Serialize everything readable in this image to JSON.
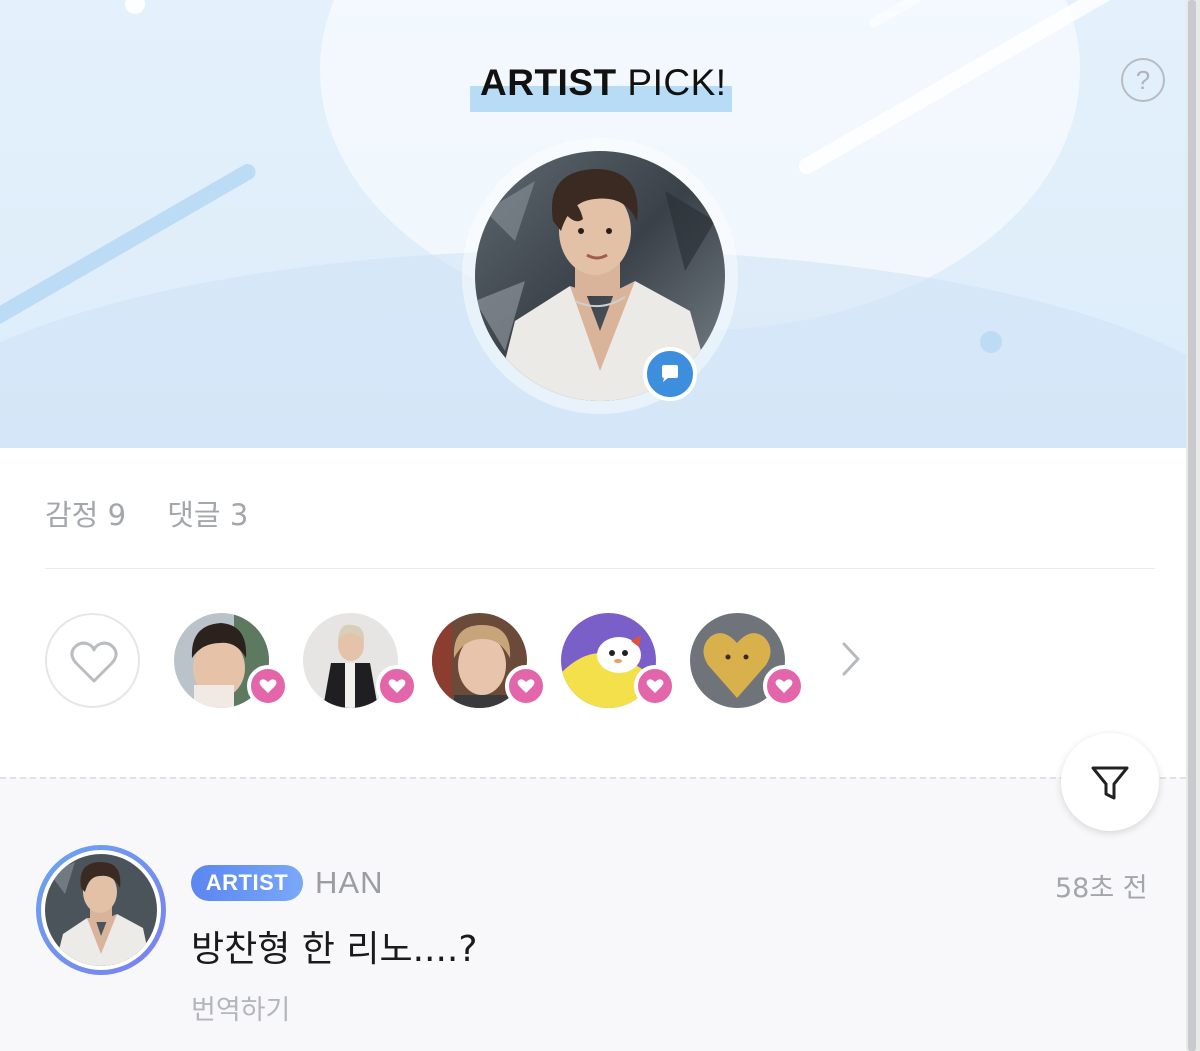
{
  "header": {
    "title_bold": "ARTIST",
    "title_light": "PICK!",
    "help_label": "?",
    "help_icon": "question-circle-icon",
    "badge_icon": "chat-bubble-icon"
  },
  "stats": {
    "emotions": "감정 9",
    "comments": "댓글 3"
  },
  "reactions": {
    "like_icon": "heart-outline-icon",
    "badge_icon": "heart-filled-icon",
    "more_icon": "chevron-right-icon",
    "count_shown": 5
  },
  "filter": {
    "icon": "filter-funnel-icon"
  },
  "comment": {
    "badge": "ARTIST",
    "author": "HAN",
    "time": "58초 전",
    "text": "방찬형 한 리노....?",
    "translate": "번역하기"
  },
  "colors": {
    "banner": "#dcecf9",
    "accent_blue": "#3d8fdd",
    "heart_pink": "#e266a9",
    "artist_badge": "#5a86f0",
    "muted_text": "#a3a6ab"
  }
}
